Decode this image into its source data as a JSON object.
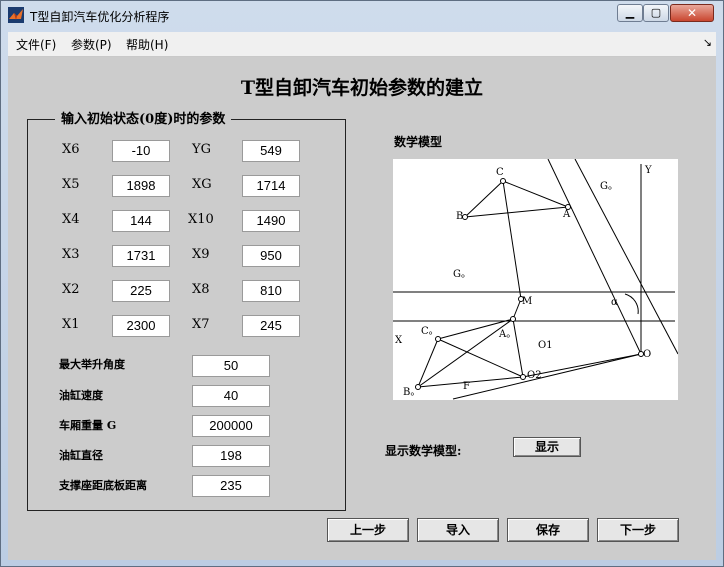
{
  "window": {
    "title": "T型自卸汽车优化分析程序"
  },
  "menu": {
    "items": [
      "文件(F)",
      "参数(P)",
      "帮助(H)"
    ],
    "arrow": "↘"
  },
  "main_title": "T型自卸汽车初始参数的建立",
  "group": {
    "title": "输入初始状态(0度)时的参数",
    "left": [
      {
        "label": "X6",
        "value": "-10"
      },
      {
        "label": "X5",
        "value": "1898"
      },
      {
        "label": "X4",
        "value": "144"
      },
      {
        "label": "X3",
        "value": "1731"
      },
      {
        "label": "X2",
        "value": "225"
      },
      {
        "label": "X1",
        "value": "2300"
      }
    ],
    "right": [
      {
        "label": "YG",
        "value": "549"
      },
      {
        "label": "XG",
        "value": "1714"
      },
      {
        "label": "X10",
        "value": "1490"
      },
      {
        "label": "X9",
        "value": "950"
      },
      {
        "label": "X8",
        "value": "810"
      },
      {
        "label": "X7",
        "value": "245"
      }
    ],
    "extra": [
      {
        "label": "最大举升角度",
        "value": "50"
      },
      {
        "label": "油缸速度",
        "value": "40"
      },
      {
        "label": "车厢重量 G",
        "value": "200000"
      },
      {
        "label": "油缸直径",
        "value": "198"
      },
      {
        "label": "支撑座距底板距离",
        "value": "235"
      }
    ]
  },
  "model": {
    "title": "数学模型",
    "labels": {
      "Y": "Y",
      "C": "C",
      "G": "G。",
      "B": "B",
      "A": "A",
      "G0": "G。",
      "M": "M",
      "alpha": "α",
      "X": "X",
      "C0": "C。",
      "A0": "A。",
      "O1": "O1",
      "O": "O",
      "O2": "O2",
      "B0": "B。",
      "F": "F"
    }
  },
  "show_model": {
    "label": "显示数学模型:",
    "button": "显示"
  },
  "nav": {
    "prev": "上一步",
    "import": "导入",
    "save": "保存",
    "next": "下一步"
  }
}
